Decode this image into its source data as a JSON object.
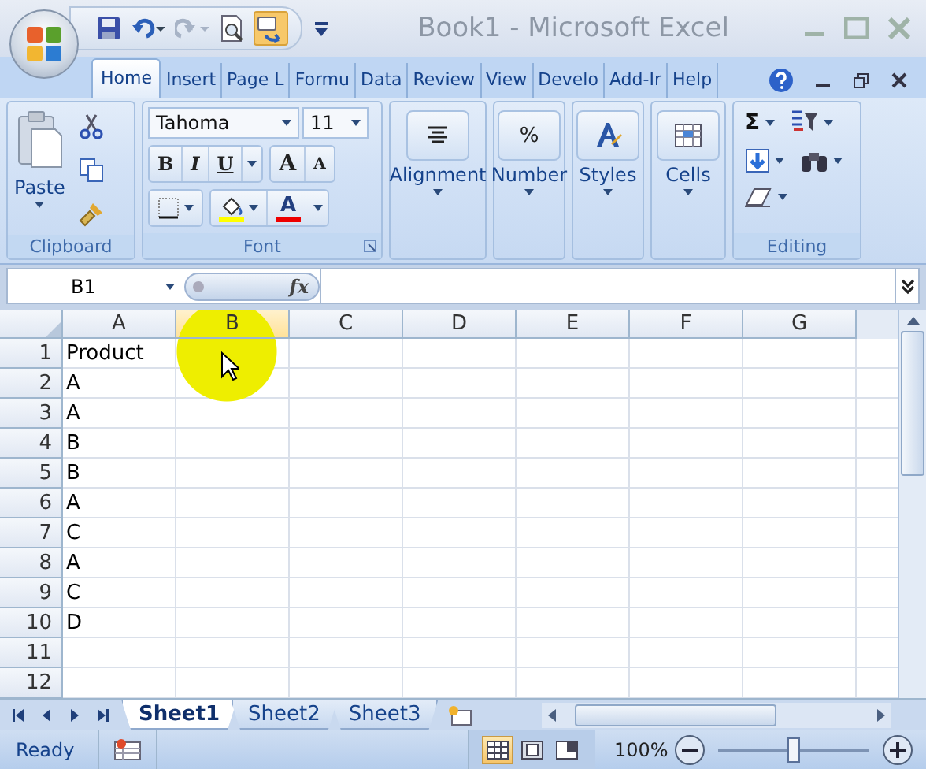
{
  "window": {
    "title": "Book1 - Microsoft Excel"
  },
  "ribbon_tabs": [
    {
      "label": "Home",
      "selected": true
    },
    {
      "label": "Insert",
      "selected": false
    },
    {
      "label": "Page L",
      "selected": false
    },
    {
      "label": "Formu",
      "selected": false
    },
    {
      "label": "Data",
      "selected": false
    },
    {
      "label": "Review",
      "selected": false
    },
    {
      "label": "View",
      "selected": false
    },
    {
      "label": "Develo",
      "selected": false
    },
    {
      "label": "Add-Ir",
      "selected": false
    },
    {
      "label": "Help",
      "selected": false
    }
  ],
  "ribbon": {
    "clipboard": {
      "paste": "Paste",
      "label": "Clipboard"
    },
    "font": {
      "face": "Tahoma",
      "size": "11",
      "bold": "B",
      "italic": "I",
      "underline": "U",
      "grow": "A",
      "shrink": "A",
      "font_color": "A",
      "label": "Font"
    },
    "groups": [
      {
        "kind": "alignment",
        "label": "Alignment"
      },
      {
        "kind": "number",
        "label": "Number",
        "glyph": "%"
      },
      {
        "kind": "styles",
        "label": "Styles"
      },
      {
        "kind": "cells",
        "label": "Cells"
      }
    ],
    "editing": {
      "sum": "Σ",
      "label": "Editing"
    }
  },
  "formula_bar": {
    "name_box": "B1",
    "fx": "fx"
  },
  "grid": {
    "columns": [
      {
        "label": "A",
        "selected": false
      },
      {
        "label": "B",
        "selected": true
      },
      {
        "label": "C",
        "selected": false
      },
      {
        "label": "D",
        "selected": false
      },
      {
        "label": "E",
        "selected": false
      },
      {
        "label": "F",
        "selected": false
      },
      {
        "label": "G",
        "selected": false
      }
    ],
    "rows": [
      {
        "number": "1",
        "cells": [
          "Product"
        ]
      },
      {
        "number": "2",
        "cells": [
          "A"
        ]
      },
      {
        "number": "3",
        "cells": [
          "A"
        ]
      },
      {
        "number": "4",
        "cells": [
          "B"
        ]
      },
      {
        "number": "5",
        "cells": [
          "B"
        ]
      },
      {
        "number": "6",
        "cells": [
          "A"
        ]
      },
      {
        "number": "7",
        "cells": [
          "C"
        ]
      },
      {
        "number": "8",
        "cells": [
          "A"
        ]
      },
      {
        "number": "9",
        "cells": [
          "C"
        ]
      },
      {
        "number": "10",
        "cells": [
          "D"
        ]
      },
      {
        "number": "11"
      },
      {
        "number": "12"
      }
    ]
  },
  "sheet_tabs": [
    {
      "label": "Sheet1",
      "selected": true
    },
    {
      "label": "Sheet2",
      "selected": false
    },
    {
      "label": "Sheet3",
      "selected": false
    }
  ],
  "status_bar": {
    "text": "Ready",
    "views": [
      {
        "selected": true
      },
      {
        "selected": false
      },
      {
        "selected": false
      }
    ],
    "zoom": "100%",
    "level": 0.5
  }
}
